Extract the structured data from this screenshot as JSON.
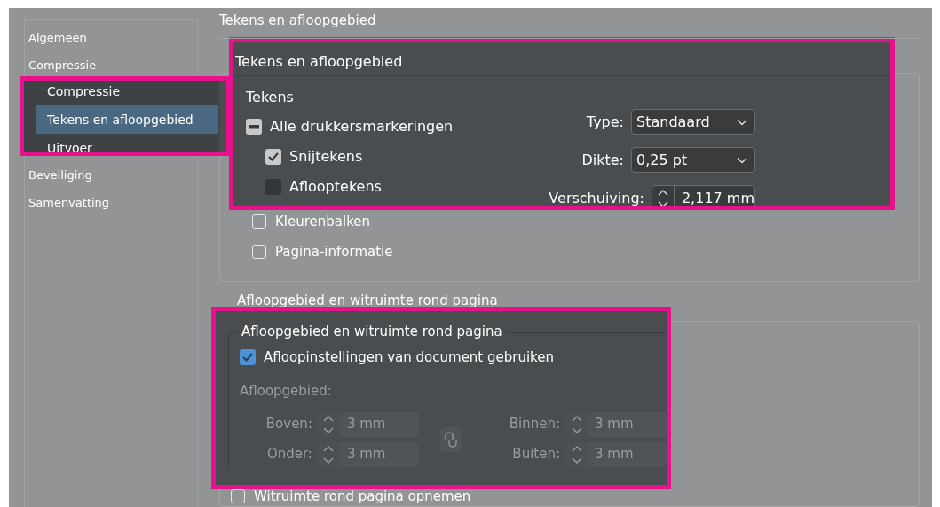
{
  "sidebar": {
    "items": [
      {
        "label": "Algemeen",
        "selected": false
      },
      {
        "label": "Compressie",
        "selected": false
      },
      {
        "label": "Beveiliging",
        "selected": false
      },
      {
        "label": "Samenvatting",
        "selected": false
      }
    ]
  },
  "main": {
    "heading": "Tekens en afloopgebied",
    "marks_options": [
      {
        "label": "Kleurenbalken",
        "checked": false
      },
      {
        "label": "Pagina-informatie",
        "checked": false
      }
    ],
    "bleed_heading": "Afloopgebied en witruimte rond pagina",
    "slug_option": {
      "label": "Witruimte rond pagina opnemen",
      "checked": false
    }
  },
  "marks_zoom": {
    "title": "Tekens en afloopgebied",
    "legend": "Tekens",
    "options": [
      {
        "label": "Alle drukkersmarkeringen",
        "checked": true,
        "indeterminate": true
      },
      {
        "label": "Snijtekens",
        "checked": true,
        "indeterminate": false
      },
      {
        "label": "Aflooptekens",
        "checked": false,
        "indeterminate": false
      }
    ],
    "fields": [
      {
        "label": "Type:",
        "value": "Standaard",
        "kind": "select"
      },
      {
        "label": "Dikte:",
        "value": "0,25 pt",
        "kind": "select"
      },
      {
        "label": "Verschuiving:",
        "value": "2,117 mm",
        "kind": "spinner"
      }
    ]
  },
  "sidebar_zoom": {
    "items": [
      {
        "label": "Compressie",
        "selected": false
      },
      {
        "label": "Tekens en afloopgebied",
        "selected": true
      },
      {
        "label": "Uitvoer",
        "selected": false
      }
    ]
  },
  "bleed_zoom": {
    "legend": "Afloopgebied en witruimte rond pagina",
    "use_document": {
      "label": "Afloopinstellingen van document gebruiken",
      "checked": true
    },
    "section_label": "Afloopgebied:",
    "disabled": true,
    "fields": [
      {
        "label": "Boven:",
        "value": "3 mm"
      },
      {
        "label": "Binnen:",
        "value": "3 mm"
      },
      {
        "label": "Onder:",
        "value": "3 mm"
      },
      {
        "label": "Buiten:",
        "value": "3 mm"
      }
    ]
  }
}
